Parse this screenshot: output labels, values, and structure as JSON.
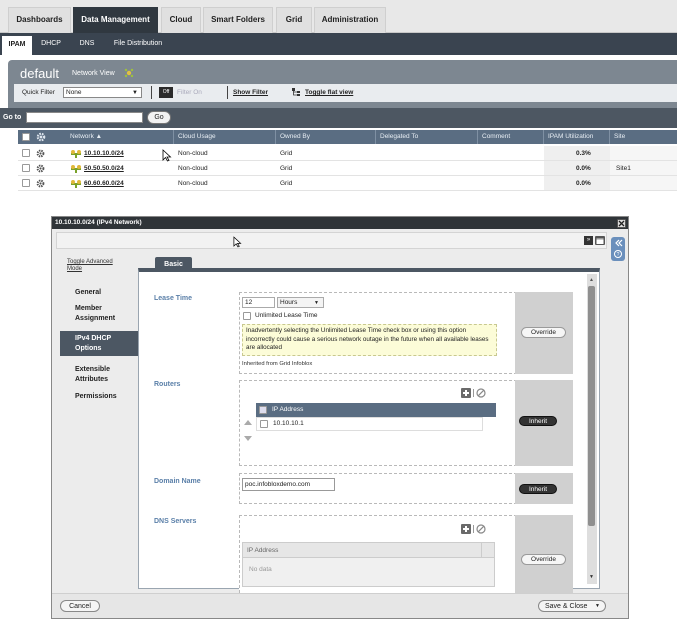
{
  "top_nav": {
    "tabs": [
      "Dashboards",
      "Data Management",
      "Cloud",
      "Smart Folders",
      "Grid",
      "Administration"
    ],
    "active": "Data Management"
  },
  "sub_nav": {
    "tabs": [
      "IPAM",
      "DHCP",
      "DNS",
      "File Distribution"
    ],
    "active": "IPAM"
  },
  "grid": {
    "view_title": "default",
    "network_view_label": "Network View",
    "quick_filter_label": "Quick Filter",
    "quick_filter_value": "None",
    "filter_toggle": "Off",
    "filter_on_label": "Filter On",
    "show_filter": "Show Filter",
    "toggle_flat_view": "Toggle flat view",
    "goto_label": "Go to",
    "go_button": "Go",
    "columns": [
      "Network",
      "Cloud Usage",
      "Owned By",
      "Delegated To",
      "Comment",
      "IPAM Utilization",
      "Site"
    ],
    "rows": [
      {
        "network": "10.10.10.0/24",
        "cloud_usage": "Non-cloud",
        "owned_by": "Grid",
        "utilization": "0.3%",
        "site": ""
      },
      {
        "network": "50.50.50.0/24",
        "cloud_usage": "Non-cloud",
        "owned_by": "Grid",
        "utilization": "0.0%",
        "site": "Site1"
      },
      {
        "network": "60.60.60.0/24",
        "cloud_usage": "Non-cloud",
        "owned_by": "Grid",
        "utilization": "0.0%",
        "site": ""
      }
    ]
  },
  "dialog": {
    "title": "10.10.10.0/24 (IPv4 Network)",
    "toggle_advanced": "Toggle Advanced Mode",
    "tab": "Basic",
    "nav_items": [
      "General",
      "Member Assignment",
      "IPv4 DHCP Options",
      "Extensible Attributes",
      "Permissions"
    ],
    "active_nav": "IPv4 DHCP Options",
    "lease_time": {
      "label": "Lease Time",
      "value": "12",
      "unit": "Hours",
      "unlimited_label": "Unlimited Lease Time",
      "warning": "Inadvertently selecting the Unlimited Lease Time check box or using this option incorrectly could cause a serious network outage in the future when all available leases are allocated",
      "inherited": "Inherited from Grid Infoblox",
      "button": "Override"
    },
    "routers": {
      "label": "Routers",
      "column": "IP Address",
      "items": [
        "10.10.10.1"
      ],
      "button": "Inherit"
    },
    "domain_name": {
      "label": "Domain Name",
      "value": "poc.infobloxdemo.com",
      "button": "Inherit"
    },
    "dns_servers": {
      "label": "DNS Servers",
      "column": "IP Address",
      "empty": "No data",
      "button": "Override"
    },
    "cancel_button": "Cancel",
    "save_button": "Save & Close"
  }
}
